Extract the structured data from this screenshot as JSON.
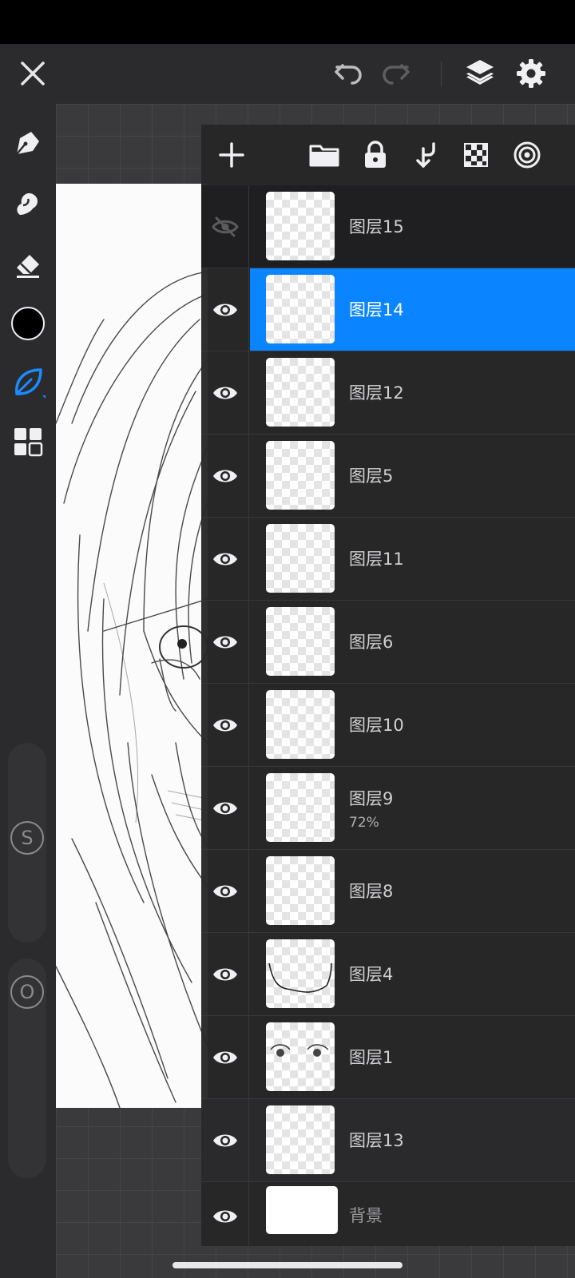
{
  "topbar": {
    "close_icon": "close-icon",
    "undo_icon": "undo-icon",
    "redo_icon": "redo-icon",
    "layers_icon": "layers-icon",
    "settings_icon": "gear-icon"
  },
  "left_toolbar": {
    "tools": [
      "brush-pen-icon",
      "smudge-icon",
      "eraser-icon",
      "color-swatch",
      "lasso-leaf-icon",
      "grid-menu-icon"
    ],
    "current_color": "#000000",
    "size_slider_label": "S",
    "opacity_slider_label": "O"
  },
  "layer_panel": {
    "header_icons": [
      "add-layer-icon",
      "folder-icon",
      "lock-icon",
      "merge-down-icon",
      "alpha-lock-icon",
      "target-icon"
    ],
    "layers": [
      {
        "name": "图层15",
        "visible": false,
        "selected": false
      },
      {
        "name": "图层14",
        "visible": true,
        "selected": true
      },
      {
        "name": "图层12",
        "visible": true,
        "selected": false
      },
      {
        "name": "图层5",
        "visible": true,
        "selected": false
      },
      {
        "name": "图层11",
        "visible": true,
        "selected": false
      },
      {
        "name": "图层6",
        "visible": true,
        "selected": false
      },
      {
        "name": "图层10",
        "visible": true,
        "selected": false
      },
      {
        "name": "图层9",
        "visible": true,
        "selected": false,
        "opacity": "72%"
      },
      {
        "name": "图层8",
        "visible": true,
        "selected": false
      },
      {
        "name": "图层4",
        "visible": true,
        "selected": false
      },
      {
        "name": "图层1",
        "visible": true,
        "selected": false
      },
      {
        "name": "图层13",
        "visible": true,
        "selected": false
      }
    ],
    "background_layer": {
      "name": "背景",
      "visible": true
    }
  },
  "colors": {
    "selected": "#0a84ff",
    "panel": "#262628",
    "toolbar": "#2b2b2d",
    "active_tool": "#1a8cff"
  }
}
